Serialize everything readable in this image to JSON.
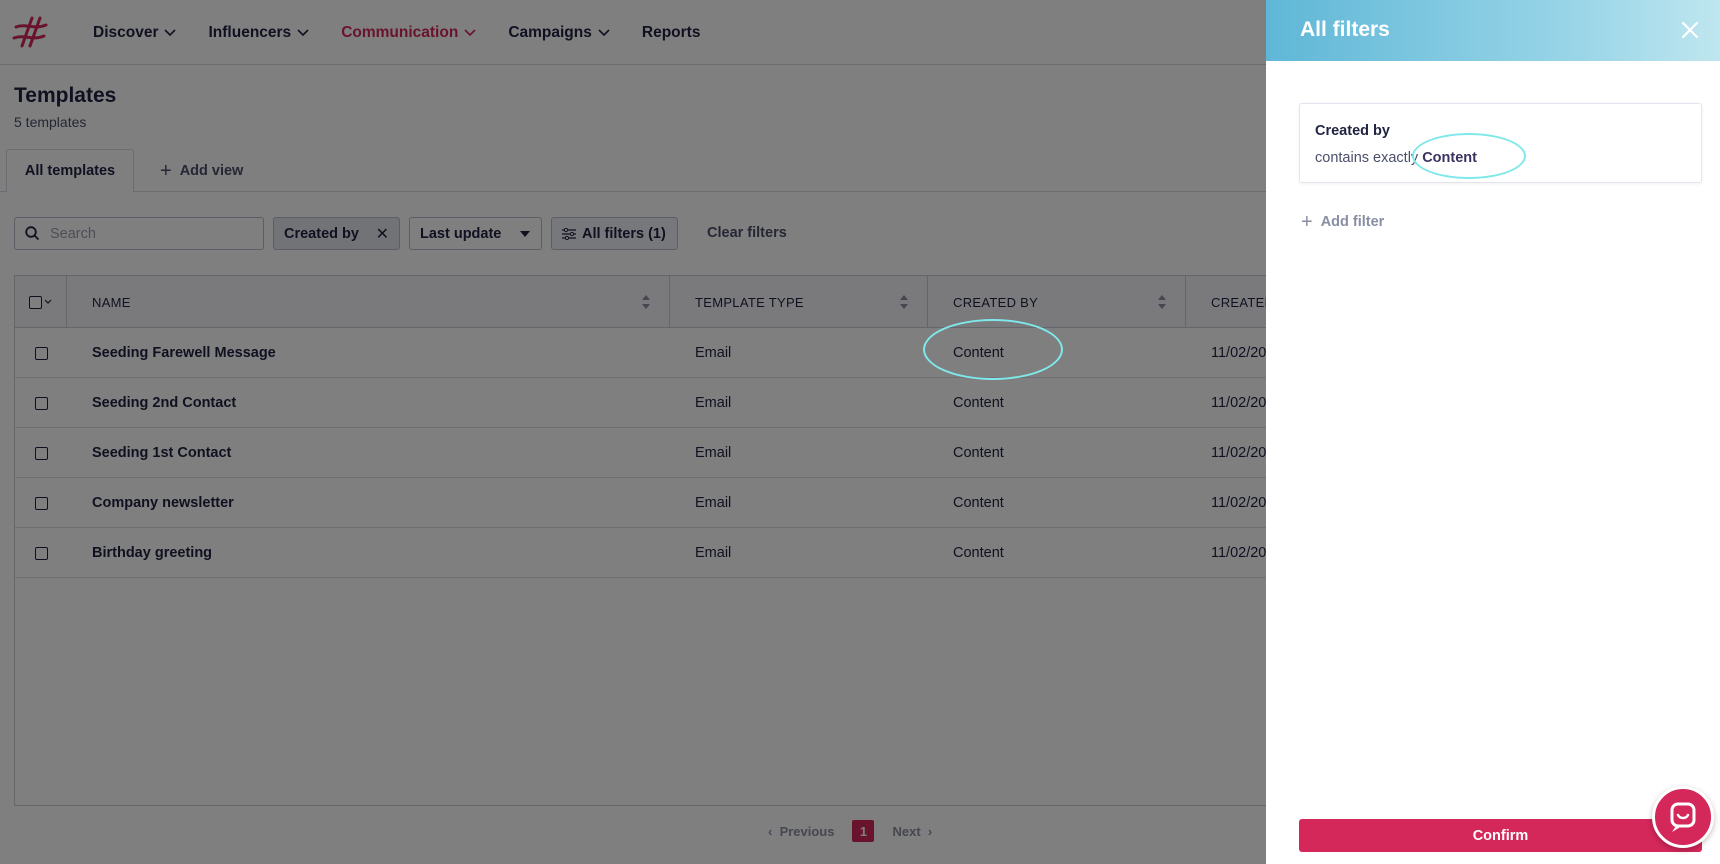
{
  "nav": {
    "items": [
      {
        "label": "Discover",
        "dropdown": true,
        "active": false
      },
      {
        "label": "Influencers",
        "dropdown": true,
        "active": false
      },
      {
        "label": "Communication",
        "dropdown": true,
        "active": true
      },
      {
        "label": "Campaigns",
        "dropdown": true,
        "active": false
      },
      {
        "label": "Reports",
        "dropdown": false,
        "active": false
      }
    ]
  },
  "page": {
    "title": "Templates",
    "subtitle": "5 templates"
  },
  "tabs": {
    "active_label": "All templates",
    "add_view_label": "Add view"
  },
  "toolbar": {
    "search_placeholder": "Search",
    "created_by_chip": "Created by",
    "last_update_chip": "Last update",
    "all_filters_chip": "All filters (1)",
    "clear_filters": "Clear filters"
  },
  "table": {
    "columns": [
      "NAME",
      "TEMPLATE TYPE",
      "CREATED BY",
      "CREATED"
    ],
    "rows": [
      {
        "name": "Seeding Farewell Message",
        "type": "Email",
        "created_by": "Content",
        "created": "11/02/20"
      },
      {
        "name": "Seeding 2nd Contact",
        "type": "Email",
        "created_by": "Content",
        "created": "11/02/20"
      },
      {
        "name": "Seeding 1st Contact",
        "type": "Email",
        "created_by": "Content",
        "created": "11/02/20"
      },
      {
        "name": "Company newsletter",
        "type": "Email",
        "created_by": "Content",
        "created": "11/02/20"
      },
      {
        "name": "Birthday greeting",
        "type": "Email",
        "created_by": "Content",
        "created": "11/02/20"
      }
    ]
  },
  "pagination": {
    "previous": "Previous",
    "current": "1",
    "next": "Next"
  },
  "panel": {
    "title": "All filters",
    "filter": {
      "label": "Created by",
      "condition": "contains exactly",
      "value": "Content"
    },
    "add_filter": "Add filter",
    "confirm": "Confirm"
  },
  "colors": {
    "accent": "#d4275a",
    "annotation": "#7fe8ea",
    "panel_header_start": "#5fb7d7",
    "panel_header_end": "#bfe6ef"
  }
}
